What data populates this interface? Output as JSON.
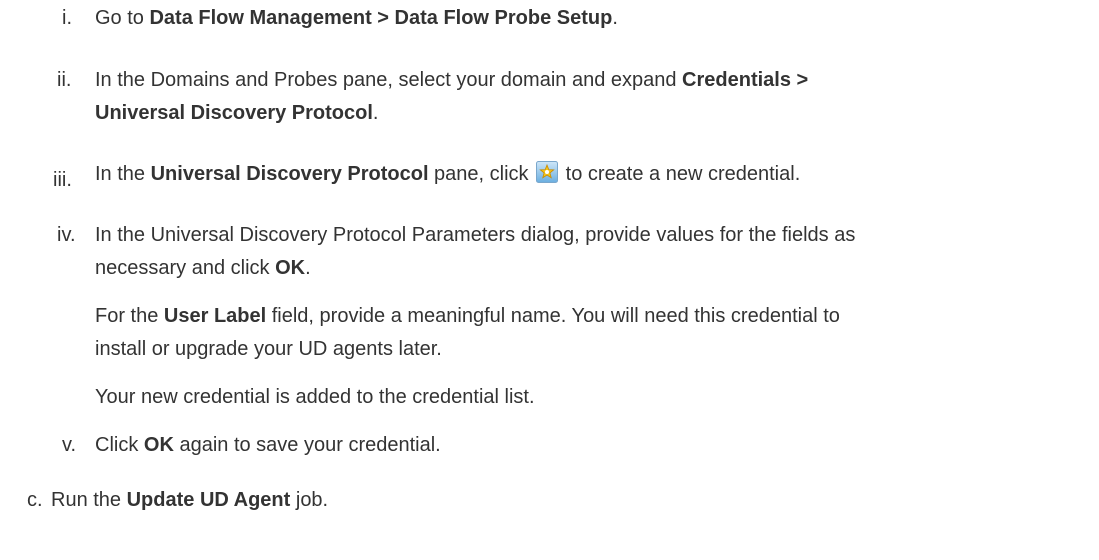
{
  "steps": {
    "i": {
      "num": "i.",
      "pre": "Go to ",
      "bold": "Data Flow Management > Data Flow Probe Setup",
      "post": "."
    },
    "ii": {
      "num": "ii.",
      "line1_pre": "In the Domains and Probes pane, select your domain and expand ",
      "line1_bold": "Credentials >",
      "line2_bold": "Universal Discovery Protocol",
      "line2_post": "."
    },
    "iii": {
      "num": "iii.",
      "pre": "In the ",
      "bold": "Universal Discovery Protocol",
      "mid": " pane, click ",
      "icon": "new-item-icon",
      "post": " to create a new credential."
    },
    "iv": {
      "num": "iv.",
      "line1": "In the Universal Discovery Protocol Parameters dialog, provide values for the fields as",
      "line2_pre": "necessary and click ",
      "line2_bold": "OK",
      "line2_post": ".",
      "para1_line1_pre": "For the ",
      "para1_line1_bold": "User Label",
      "para1_line1_post": " field, provide a meaningful name. You will need this credential to",
      "para1_line2": "install or upgrade your UD agents later.",
      "para2": "Your new credential is added to the credential list."
    },
    "v": {
      "num": "v.",
      "pre": "Click ",
      "bold": "OK",
      "post": " again to save your credential."
    },
    "c": {
      "num": "c.",
      "pre": "Run the ",
      "bold": "Update UD Agent",
      "post": " job."
    }
  },
  "colors": {
    "text": "#333333",
    "icon_bg": "#6aaee0",
    "icon_star": "#f5c518"
  }
}
